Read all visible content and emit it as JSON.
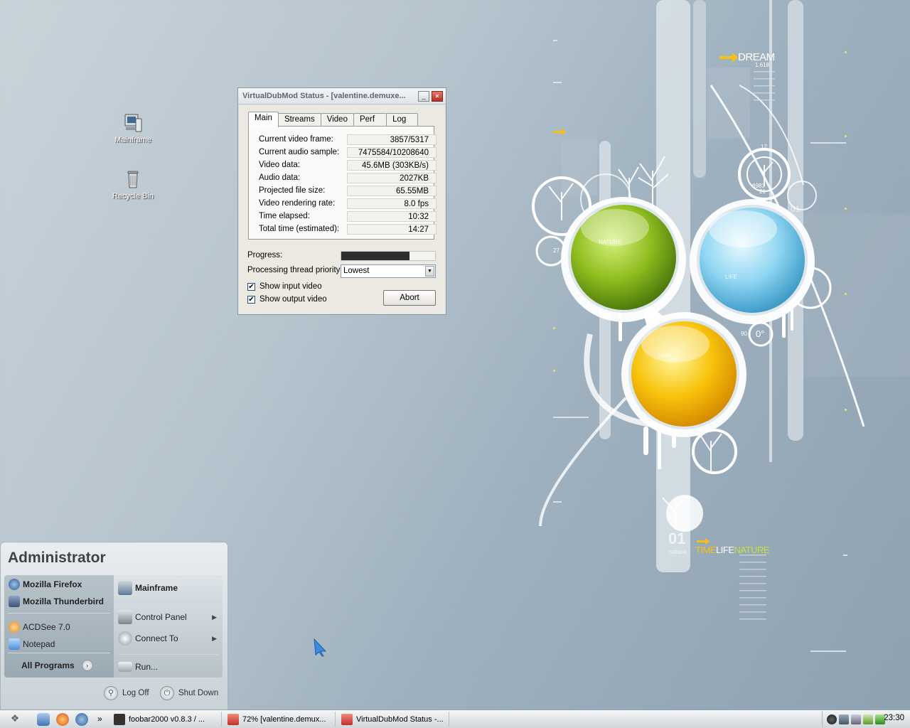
{
  "desktop": {
    "icons": [
      {
        "label": "Mainframe",
        "icon": "computer-icon"
      },
      {
        "label": "Recycle Bin",
        "icon": "recycle-bin-icon"
      }
    ]
  },
  "wallpaper": {
    "top_text": "DREAM",
    "top_number": "1.618",
    "orb_labels": [
      "NATURE",
      "LIFE",
      "TIME"
    ],
    "bottom_words": [
      "TIME",
      "LIFE",
      "NATURE"
    ],
    "bottom_number": "01",
    "bottom_small": "nature",
    "ring_number_a": "8983",
    "ring_number_b": "21",
    "side_numbers": [
      "27",
      "90",
      "0°",
      "12",
      "01"
    ]
  },
  "vd": {
    "title": "VirtualDubMod Status - [valentine.demuxe...",
    "minimize": "_",
    "close": "×",
    "tabs": [
      "Main",
      "Streams",
      "Video",
      "Perf",
      "Log"
    ],
    "active_tab": "Main",
    "stats": [
      {
        "label": "Current video frame:",
        "value": "3857/5317"
      },
      {
        "label": "Current audio sample:",
        "value": "7475584/10208640"
      },
      {
        "label": "Video data:",
        "value": "45.6MB (303KB/s)"
      },
      {
        "label": "Audio data:",
        "value": "2027KB"
      },
      {
        "label": "Projected file size:",
        "value": "65.55MB"
      },
      {
        "label": "Video rendering rate:",
        "value": "8.0 fps"
      },
      {
        "label": "Time elapsed:",
        "value": "10:32"
      },
      {
        "label": "Total time (estimated):",
        "value": "14:27"
      }
    ],
    "progress_label": "Progress:",
    "progress_fraction": 0.73,
    "priority_label": "Processing thread priority:",
    "priority_value": "Lowest",
    "show_input_label": "Show input video",
    "show_output_label": "Show output video",
    "show_input_checked": true,
    "show_output_checked": true,
    "abort_label": "Abort",
    "check_mark": "✔"
  },
  "start_menu": {
    "user": "Administrator",
    "pinned": [
      {
        "label": "Mozilla Firefox",
        "icon": "firefox-icon",
        "color": "#5a7fb0"
      },
      {
        "label": "Mozilla Thunderbird",
        "icon": "thunderbird-icon",
        "color": "#4a6180"
      }
    ],
    "recent": [
      {
        "label": "ACDSee 7.0",
        "icon": "acdsee-icon",
        "color": "#e58a1c"
      },
      {
        "label": "Notepad",
        "icon": "notepad-icon",
        "color": "#4f8fd8"
      }
    ],
    "all_programs": "All Programs",
    "right": [
      {
        "label": "Mainframe",
        "icon": "computer-icon",
        "bold": true
      },
      {
        "label": "Control Panel",
        "icon": "control-panel-icon",
        "submenu": true
      },
      {
        "label": "Connect To",
        "icon": "connect-to-icon",
        "submenu": true
      },
      {
        "label": "Run...",
        "icon": "run-icon",
        "submenu": false
      }
    ],
    "log_off": "Log Off",
    "shut_down": "Shut Down"
  },
  "taskbar": {
    "chevron": "»",
    "buttons": [
      {
        "label": "foobar2000 v0.8.3  /  ...",
        "icon": "foobar-icon",
        "color": "#333333"
      },
      {
        "label": "72% [valentine.demux...",
        "icon": "virtualdub-icon",
        "color": "#c2302a"
      },
      {
        "label": "VirtualDubMod Status -...",
        "icon": "virtualdub-icon",
        "color": "#c2302a"
      }
    ],
    "clock": "23:30"
  }
}
